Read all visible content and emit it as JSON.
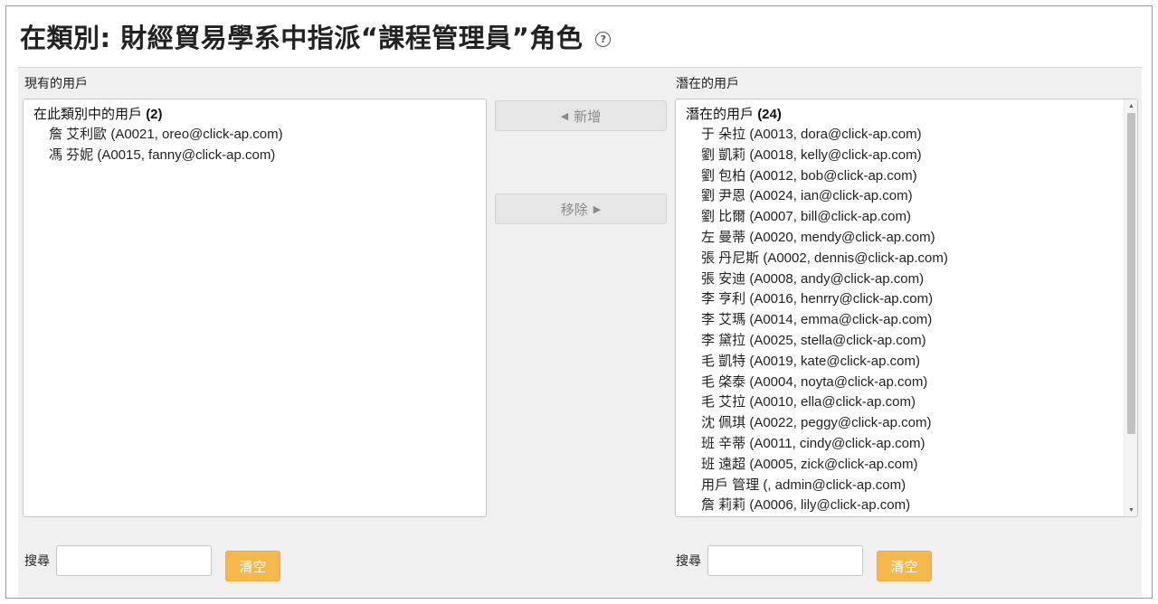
{
  "page": {
    "title": "在類別: 財經貿易學系中指派“課程管理員”角色",
    "help_icon": "?"
  },
  "existing": {
    "label": "現有的用戶",
    "group_label": "在此類別中的用戶",
    "group_count": "(2)",
    "users": [
      "詹 艾利歐 (A0021, oreo@click-ap.com)",
      "馮 芬妮 (A0015, fanny@click-ap.com)"
    ],
    "search_label": "搜尋",
    "search_value": "",
    "clear_label": "清空"
  },
  "actions": {
    "add_arrow": "◀",
    "add_label": "新增",
    "remove_label": "移除",
    "remove_arrow": "▶"
  },
  "potential": {
    "label": "潛在的用戶",
    "group_label": "潛在的用戶",
    "group_count": "(24)",
    "users": [
      "于 朵拉 (A0013, dora@click-ap.com)",
      "劉 凱莉 (A0018, kelly@click-ap.com)",
      "劉 包柏 (A0012, bob@click-ap.com)",
      "劉 尹恩 (A0024, ian@click-ap.com)",
      "劉 比爾 (A0007, bill@click-ap.com)",
      "左 曼蒂 (A0020, mendy@click-ap.com)",
      "張 丹尼斯 (A0002, dennis@click-ap.com)",
      "張 安迪 (A0008, andy@click-ap.com)",
      "李 亨利 (A0016, henrry@click-ap.com)",
      "李 艾瑪 (A0014, emma@click-ap.com)",
      "李 黛拉 (A0025, stella@click-ap.com)",
      "毛 凱特 (A0019, kate@click-ap.com)",
      "毛 棨泰 (A0004, noyta@click-ap.com)",
      "毛 艾拉 (A0010, ella@click-ap.com)",
      "沈 佩琪 (A0022, peggy@click-ap.com)",
      "班 辛蒂 (A0011, cindy@click-ap.com)",
      "班 遠超 (A0005, zick@click-ap.com)",
      "用戶 管理 (, admin@click-ap.com)",
      "詹 莉莉 (A0006, lily@click-ap.com)"
    ],
    "search_label": "搜尋",
    "search_value": "",
    "clear_label": "清空"
  },
  "colors": {
    "clear_button": "#f7b84b",
    "panel_background": "#f0f0f0",
    "disabled_button": "#e6e6e6"
  }
}
